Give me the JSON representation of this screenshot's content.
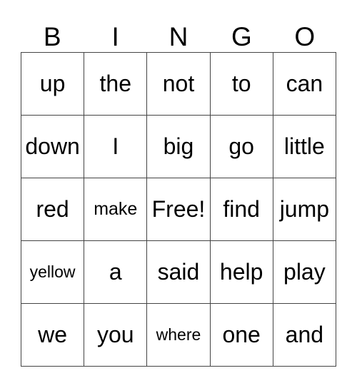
{
  "header": [
    "B",
    "I",
    "N",
    "G",
    "O"
  ],
  "rows": [
    [
      "up",
      "the",
      "not",
      "to",
      "can"
    ],
    [
      "down",
      "I",
      "big",
      "go",
      "little"
    ],
    [
      "red",
      "make",
      "Free!",
      "find",
      "jump"
    ],
    [
      "yellow",
      "a",
      "said",
      "help",
      "play"
    ],
    [
      "we",
      "you",
      "where",
      "one",
      "and"
    ]
  ]
}
